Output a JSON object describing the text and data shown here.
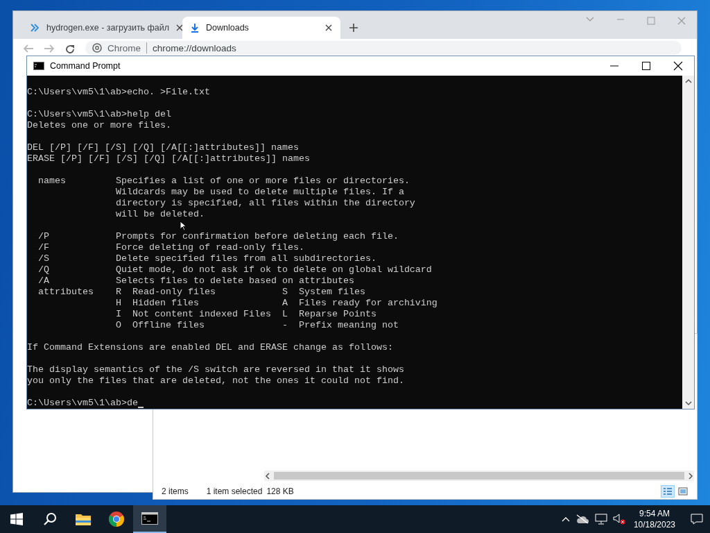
{
  "browser": {
    "tabs": [
      {
        "title": "hydrogen.exe - загрузить файл",
        "kind": "page",
        "selected": false
      },
      {
        "title": "Downloads",
        "kind": "downloads",
        "selected": true
      }
    ],
    "omnibox": {
      "site_label": "Chrome",
      "url": "chrome://downloads"
    }
  },
  "explorer": {
    "status_bar": {
      "item_count": "2 items",
      "selection": "1 item selected",
      "size": "128 KB"
    },
    "views": [
      {
        "kind": "details",
        "selected": true
      },
      {
        "kind": "large_icons",
        "selected": false
      }
    ]
  },
  "console": {
    "title": "Command Prompt",
    "blocks": [
      [
        "C:\\Users\\vm5\\1\\ab>echo. >File.txt"
      ],
      [
        "C:\\Users\\vm5\\1\\ab>help del",
        "Deletes one or more files."
      ],
      [
        "DEL [/P] [/F] [/S] [/Q] [/A[[:]attributes]] names",
        "ERASE [/P] [/F] [/S] [/Q] [/A[[:]attributes]] names"
      ],
      [
        "  names         Specifies a list of one or more files or directories.",
        "                Wildcards may be used to delete multiple files. If a",
        "                directory is specified, all files within the directory",
        "                will be deleted."
      ],
      [
        "  /P            Prompts for confirmation before deleting each file.",
        "  /F            Force deleting of read-only files.",
        "  /S            Delete specified files from all subdirectories.",
        "  /Q            Quiet mode, do not ask if ok to delete on global wildcard",
        "  /A            Selects files to delete based on attributes",
        "  attributes    R  Read-only files            S  System files",
        "                H  Hidden files               A  Files ready for archiving",
        "                I  Not content indexed Files  L  Reparse Points",
        "                O  Offline files              -  Prefix meaning not"
      ],
      [
        "If Command Extensions are enabled DEL and ERASE change as follows:"
      ],
      [
        "The display semantics of the /S switch are reversed in that it shows",
        "you only the files that are deleted, not the ones it could not find."
      ],
      [
        "C:\\Users\\vm5\\1\\ab>de"
      ]
    ]
  },
  "taskbar": {
    "apps": [
      {
        "kind": "explorer",
        "selected": false
      },
      {
        "kind": "chrome",
        "selected": false
      },
      {
        "kind": "cmd",
        "selected": true
      }
    ],
    "clock": {
      "time": "9:54 AM",
      "date": "10/18/2023"
    }
  }
}
